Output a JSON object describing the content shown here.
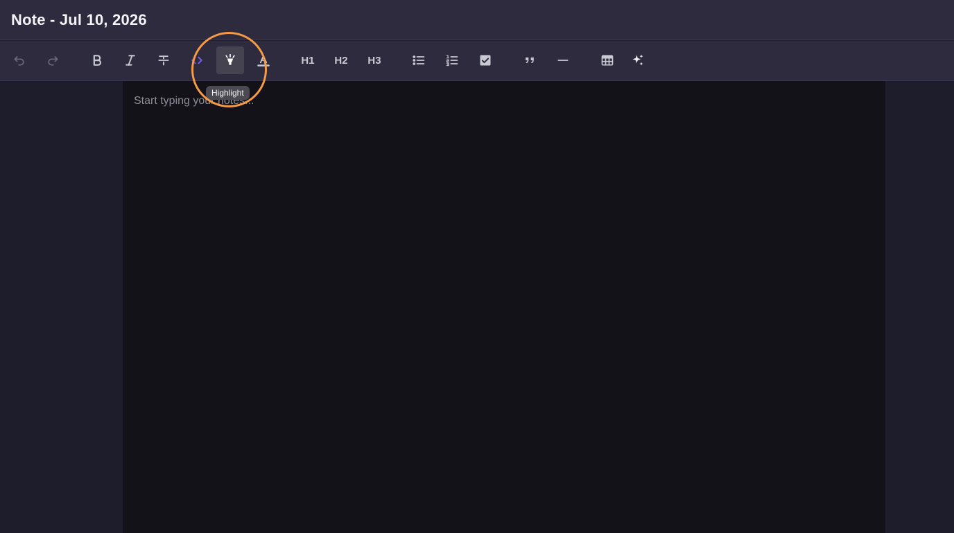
{
  "note": {
    "title": "Note - Jul 10, 2026"
  },
  "toolbar": {
    "h1_label": "H1",
    "h2_label": "H2",
    "h3_label": "H3",
    "tooltip": "Highlight"
  },
  "editor": {
    "placeholder": "Start typing your notes..."
  },
  "colors": {
    "accent_code": "#7a5cf0",
    "focus_ring": "#f59a45",
    "editor_bg": "#131218",
    "header_bg": "#2d2b3d"
  },
  "icons": [
    "undo-icon",
    "redo-icon",
    "bold-icon",
    "italic-icon",
    "strikethrough-icon",
    "code-icon",
    "highlight-icon",
    "text-color-icon",
    "bullet-list-icon",
    "ordered-list-icon",
    "checkbox-icon",
    "quote-icon",
    "horizontal-rule-icon",
    "table-icon",
    "sparkles-icon"
  ]
}
